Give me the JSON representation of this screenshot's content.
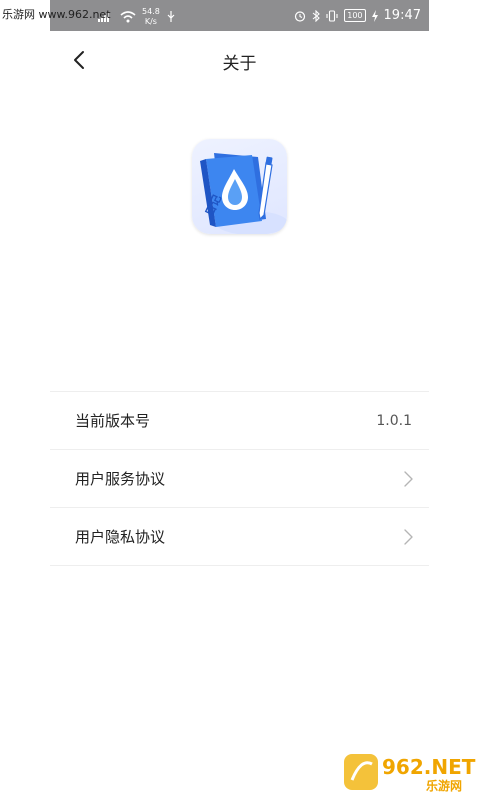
{
  "watermark": {
    "top_text": "乐游网 www.962.net",
    "bottom_brand": "962.NET",
    "bottom_sub": "乐游网"
  },
  "status_bar": {
    "net_speed_value": "54.8",
    "net_speed_unit": "K/s",
    "battery": "100",
    "time": "19:47"
  },
  "navbar": {
    "title": "关于",
    "back_icon": "chevron-left-icon"
  },
  "app": {
    "icon_text": "日记",
    "icon_name": "water-drop-notebook-icon"
  },
  "settings": [
    {
      "label": "当前版本号",
      "value": "1.0.1",
      "has_chevron": false
    },
    {
      "label": "用户服务协议",
      "value": "",
      "has_chevron": true
    },
    {
      "label": "用户隐私协议",
      "value": "",
      "has_chevron": true
    }
  ],
  "colors": {
    "status_bar_bg": "#8e8e90",
    "accent_blue": "#2f6fe0",
    "divider": "#eeeeee"
  }
}
